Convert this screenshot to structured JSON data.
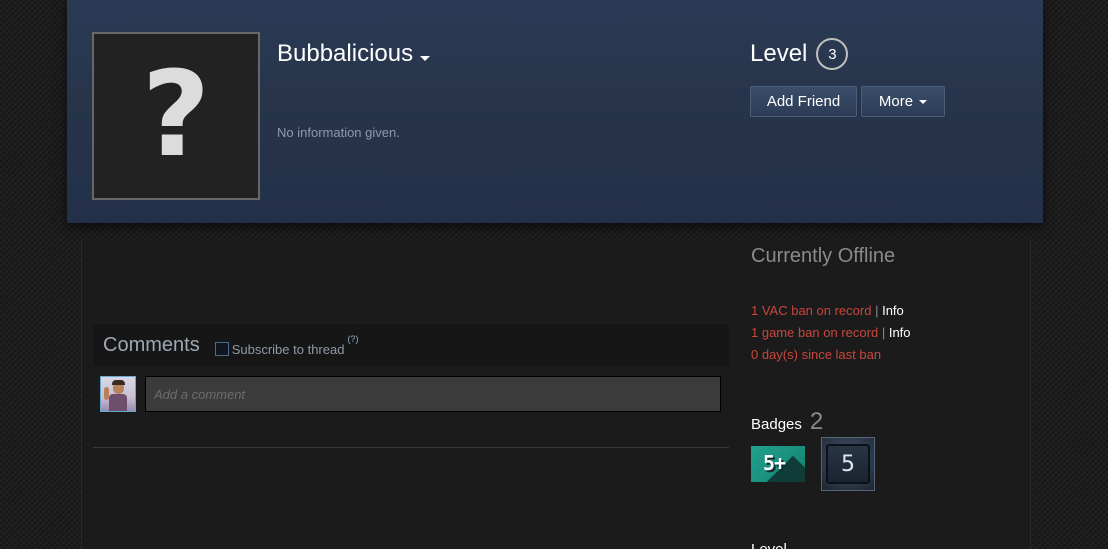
{
  "profile": {
    "avatar_placeholder": "?",
    "persona_name": "Bubbalicious",
    "summary": "No information given.",
    "level_label": "Level",
    "level_value": "3",
    "add_friend_label": "Add Friend",
    "more_label": "More"
  },
  "comments": {
    "title": "Comments",
    "subscribe_label": "Subscribe to thread",
    "subscribe_help": "(?)",
    "input_placeholder": "Add a comment"
  },
  "sidebar": {
    "status": "Currently Offline",
    "bans": [
      {
        "text": "1 VAC ban on record",
        "separator": "|",
        "link": "Info"
      },
      {
        "text": "1 game ban on record",
        "separator": "|",
        "link": "Info"
      },
      {
        "text": "0 day(s) since last ban"
      }
    ],
    "badges_label": "Badges",
    "badges_count": "2",
    "badges": [
      {
        "name": "years-of-service-badge",
        "text": "5+"
      },
      {
        "name": "steam-level-badge",
        "text": "5"
      }
    ],
    "next_section_label": "Level"
  },
  "colors": {
    "header_bg": "#2b3b56",
    "ban_red": "#c9463d",
    "accent_teal": "#1fa28e"
  }
}
